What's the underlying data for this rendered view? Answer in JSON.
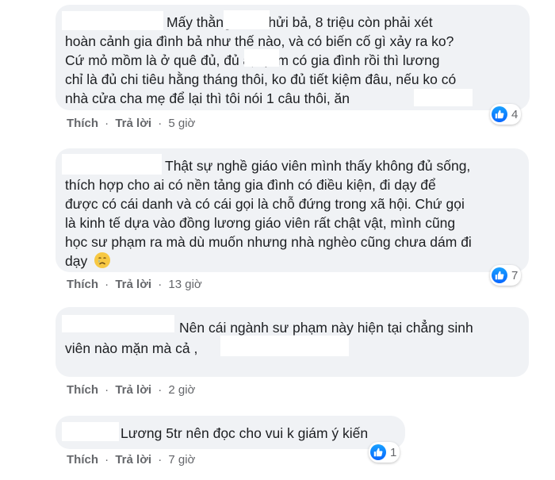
{
  "comments": [
    {
      "lines": [
        "Mấy thằng          vào chửi bả, 8 triệu còn phải xét",
        "hoàn cảnh gia đình bả như thế nào, và có biến cố gì xảy ra ko?",
        "Cứ mỏ mồm là ở quê đủ, đủ        à, tụi m có gia đình rồi thì lương",
        "chỉ là đủ chi tiêu hằng tháng thôi, ko đủ tiết kiệm đâu, nếu ko có",
        "nhà cửa cha mẹ để lại thì tôi nói 1 câu thôi, ăn"
      ],
      "like": "Thích",
      "reply": "Trả lời",
      "time": "5 giờ",
      "reactions": "4"
    },
    {
      "lines": [
        "Thật sự nghề giáo viên mình thấy không đủ sống,",
        "thích hợp cho ai có nền tảng gia đình có điều kiện, đi dạy để",
        "được có cái danh và có cái gọi là chỗ đứng trong xã hội. Chứ gọi",
        "là kinh tế dựa vào đồng lương giáo viên rất chật vật, mình cũng",
        "học sư phạm ra mà dù muốn nhưng nhà nghèo cũng chưa dám đi",
        "dạy"
      ],
      "like": "Thích",
      "reply": "Trả lời",
      "time": "13 giờ",
      "reactions": "7"
    },
    {
      "lines": [
        "Nên cái ngành sư phạm này hiện tại chẳng sinh",
        "viên nào mặn mà cả ,"
      ],
      "like": "Thích",
      "reply": "Trả lời",
      "time": "2 giờ"
    },
    {
      "lines": [
        "Lương 5tr nên đọc cho vui k giám ý kiến"
      ],
      "like": "Thích",
      "reply": "Trả lời",
      "time": "7 giờ",
      "reactions": "1"
    }
  ],
  "separator": "·",
  "icons": {
    "reaction": "thumbs-up-icon",
    "emoji": "crying-face-icon"
  },
  "colors": {
    "bubble": "#f0f2f5",
    "action_text": "#65676b",
    "like_blue": "#0866ff"
  }
}
